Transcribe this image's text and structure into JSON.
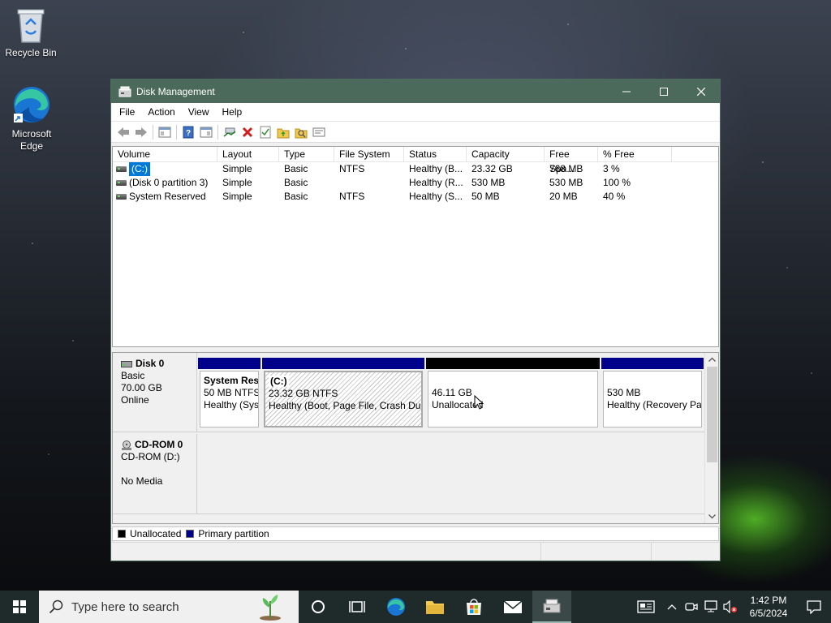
{
  "desktop": {
    "icons": [
      {
        "label": "Recycle Bin",
        "icon": "recycle-bin-icon"
      },
      {
        "label": "Microsoft Edge",
        "icon": "edge-icon"
      }
    ]
  },
  "window": {
    "title": "Disk Management",
    "menu": [
      "File",
      "Action",
      "View",
      "Help"
    ],
    "toolbar_icons": [
      "back-icon",
      "forward-icon",
      "console-tree-icon",
      "help-icon",
      "properties-icon",
      "connect-icon",
      "delete-icon",
      "check-icon",
      "folder-up-icon",
      "search-folder-icon",
      "details-icon"
    ]
  },
  "volume_list": {
    "columns": [
      "Volume",
      "Layout",
      "Type",
      "File System",
      "Status",
      "Capacity",
      "Free Spa...",
      "% Free"
    ],
    "rows": [
      {
        "volume": "(C:)",
        "layout": "Simple",
        "type": "Basic",
        "fs": "NTFS",
        "status": "Healthy (B...",
        "capacity": "23.32 GB",
        "free": "768 MB",
        "pct": "3 %",
        "selected": true
      },
      {
        "volume": "(Disk 0 partition 3)",
        "layout": "Simple",
        "type": "Basic",
        "fs": "",
        "status": "Healthy (R...",
        "capacity": "530 MB",
        "free": "530 MB",
        "pct": "100 %",
        "selected": false
      },
      {
        "volume": "System Reserved",
        "layout": "Simple",
        "type": "Basic",
        "fs": "NTFS",
        "status": "Healthy (S...",
        "capacity": "50 MB",
        "free": "20 MB",
        "pct": "40 %",
        "selected": false
      }
    ]
  },
  "disks": [
    {
      "name": "Disk 0",
      "type": "Basic",
      "size": "70.00 GB",
      "state": "Online",
      "partitions": [
        {
          "title": "System Res",
          "line1": "50 MB NTFS",
          "line2": "Healthy (Sys",
          "kind": "primary"
        },
        {
          "title": "(C:)",
          "line1": "23.32 GB NTFS",
          "line2": "Healthy (Boot, Page File, Crash Dun",
          "kind": "primary-selected"
        },
        {
          "title": "",
          "line1": "46.11 GB",
          "line2": "Unallocated",
          "kind": "unallocated"
        },
        {
          "title": "",
          "line1": "530 MB",
          "line2": "Healthy (Recovery Pa",
          "kind": "primary"
        }
      ]
    },
    {
      "name": "CD-ROM 0",
      "type": "CD-ROM (D:)",
      "state": "No Media"
    }
  ],
  "legend": [
    {
      "label": "Unallocated",
      "color": "#000000"
    },
    {
      "label": "Primary partition",
      "color": "#00008b"
    }
  ],
  "colors": {
    "titlebar": "#4c6a5c",
    "primary": "#00008b",
    "unallocated": "#000000",
    "selection": "#0078d7"
  },
  "taskbar": {
    "search_placeholder": "Type here to search",
    "time": "1:42 PM",
    "date": "6/5/2024"
  }
}
